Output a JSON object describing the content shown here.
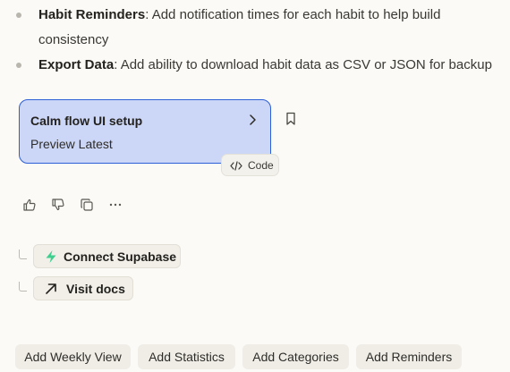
{
  "bullets": [
    {
      "bold": "Habit Reminders",
      "rest_line1": ": Add notification times for each habit to help build",
      "rest_line2": "consistency"
    },
    {
      "bold": "Export Data",
      "rest_line1": ": Add ability to download habit data as CSV or JSON for backup"
    }
  ],
  "artifact": {
    "title": "Calm flow UI setup",
    "subtitle": "Preview Latest",
    "code_label": "Code"
  },
  "links": [
    {
      "label": "Connect Supabase",
      "icon": "bolt-icon"
    },
    {
      "label": "Visit docs",
      "icon": "arrow-up-right-icon"
    }
  ],
  "suggestions": [
    "Add Weekly View",
    "Add Statistics",
    "Add Categories",
    "Add Reminders"
  ],
  "colors": {
    "card_bg": "#ccd6f6",
    "card_border": "#2d5fd6",
    "supabase_green": "#3ecf8e"
  }
}
